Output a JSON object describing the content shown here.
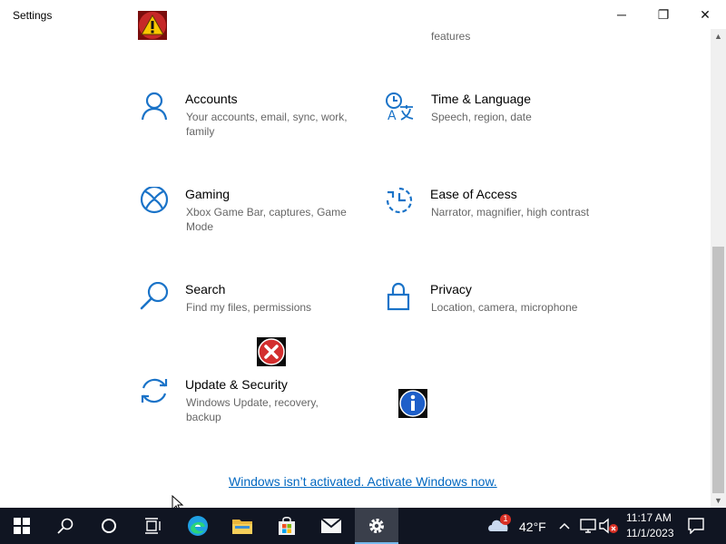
{
  "window": {
    "title": "Settings",
    "minimize_label": "─",
    "maximize_label": "❐",
    "close_label": "✕"
  },
  "cutoff_text": "features",
  "tiles": [
    {
      "name": "Accounts",
      "desc": "Your accounts, email, sync, work, family",
      "icon": "person-icon"
    },
    {
      "name": "Time & Language",
      "desc": "Speech, region, date",
      "icon": "time-language-icon"
    },
    {
      "name": "Gaming",
      "desc": "Xbox Game Bar, captures, Game Mode",
      "icon": "xbox-icon"
    },
    {
      "name": "Ease of Access",
      "desc": "Narrator, magnifier, high contrast",
      "icon": "ease-of-access-icon"
    },
    {
      "name": "Search",
      "desc": "Find my files, permissions",
      "icon": "search-icon"
    },
    {
      "name": "Privacy",
      "desc": "Location, camera, microphone",
      "icon": "lock-icon"
    },
    {
      "name": "Update & Security",
      "desc": "Windows Update, recovery, backup",
      "icon": "sync-icon"
    }
  ],
  "activation": {
    "link_text": "Windows isn’t activated. Activate Windows now."
  },
  "taskbar": {
    "weather_temp": "42°F",
    "weather_badge": "1",
    "time": "11:17 AM",
    "date": "11/1/2023"
  },
  "colors": {
    "accent": "#0067c0",
    "icon_blue": "#1a73c8",
    "taskbar_bg": "#101522"
  }
}
